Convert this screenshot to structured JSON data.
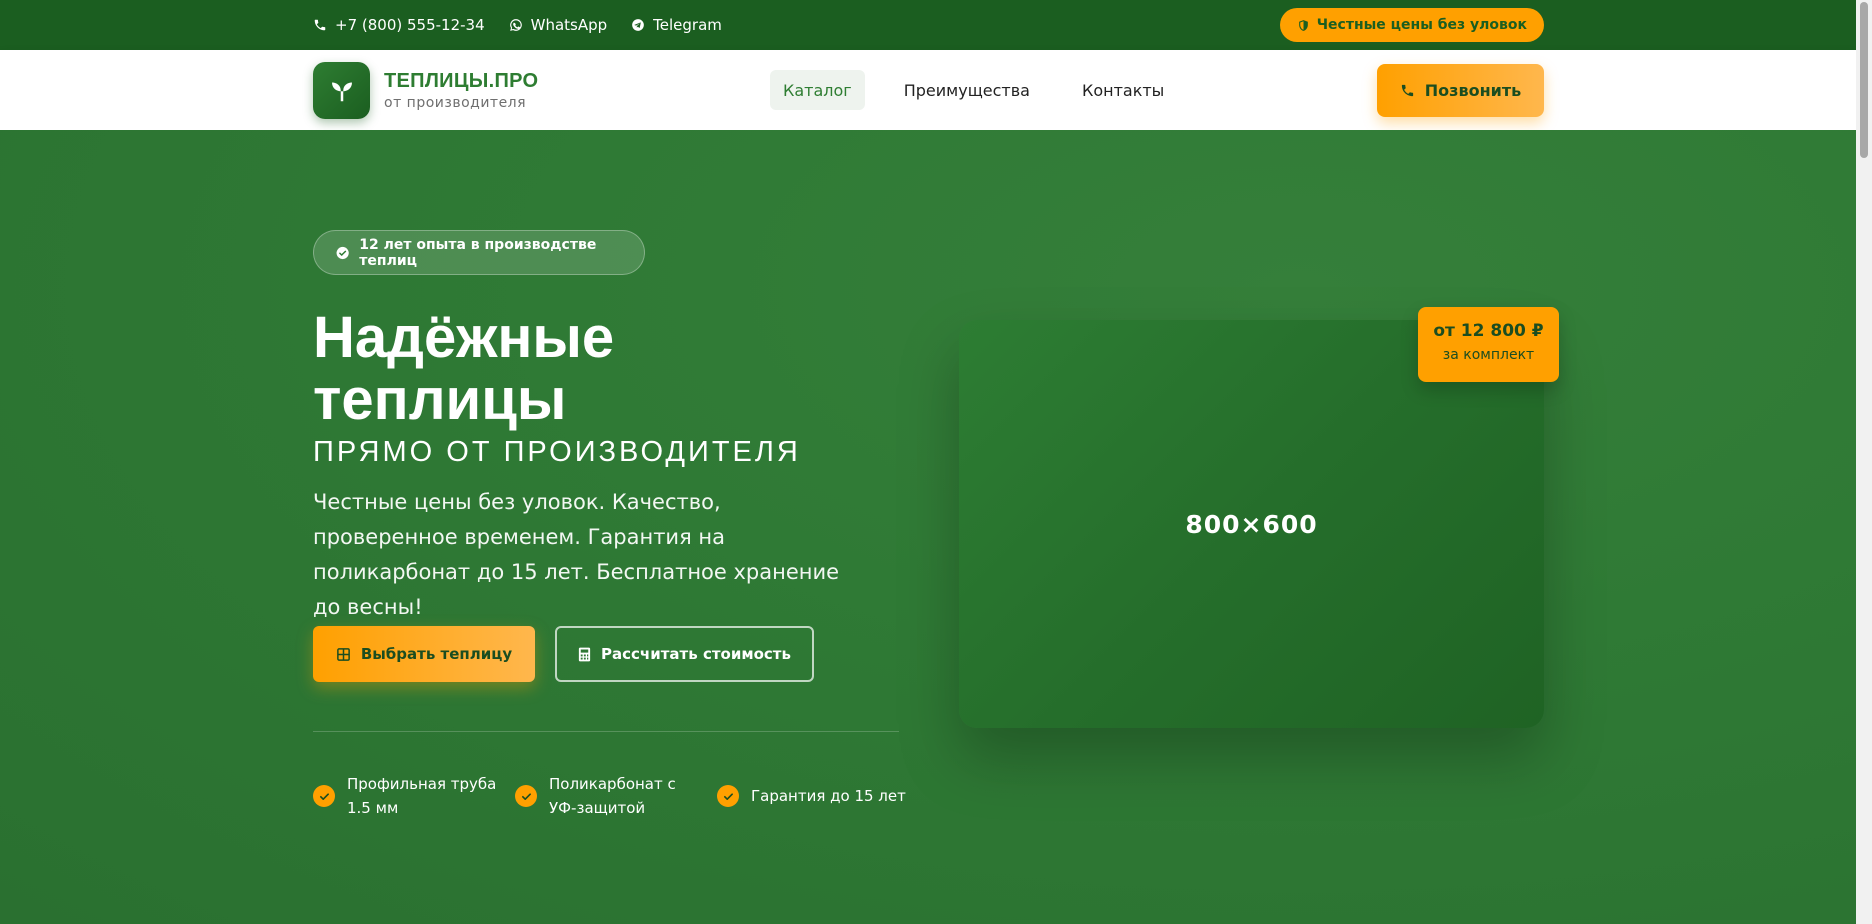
{
  "topbar": {
    "phone": "+7 (800) 555-12-34",
    "whatsapp": "WhatsApp",
    "telegram": "Telegram",
    "badge": "Честные цены без уловок"
  },
  "header": {
    "logo_title": "ТЕПЛИЦЫ.ПРО",
    "logo_sub": "от производителя",
    "nav": [
      {
        "label": "Каталог",
        "active": true
      },
      {
        "label": "Преимущества",
        "active": false
      },
      {
        "label": "Контакты",
        "active": false
      }
    ],
    "call_label": "Позвонить"
  },
  "hero": {
    "badge": "12 лет опыта в производстве теплиц",
    "title_line1": "Надёжные",
    "title_line2": "теплицы",
    "subtitle": "ПРЯМО ОТ ПРОИЗВОДИТЕЛЯ",
    "description": "Честные цены без уловок. Качество, проверенное временем. Гарантия на поликарбонат до 15 лет. Бесплатное хранение до весны!",
    "primary_button": "Выбрать теплицу",
    "secondary_button": "Рассчитать стоимость",
    "features": [
      {
        "line1": "Профильная труба",
        "line2": "1.5 мм"
      },
      {
        "line1": "Поликарбонат с",
        "line2": "УФ-защитой"
      },
      {
        "line1": "Гарантия до 15 лет",
        "line2": ""
      }
    ],
    "image_placeholder": "800×600",
    "price_main": "от 12 800 ₽",
    "price_sub": "за комплект"
  },
  "colors": {
    "brand_green": "#1b5e20",
    "hero_green": "#2e7a34",
    "accent_orange": "#ffa000"
  }
}
